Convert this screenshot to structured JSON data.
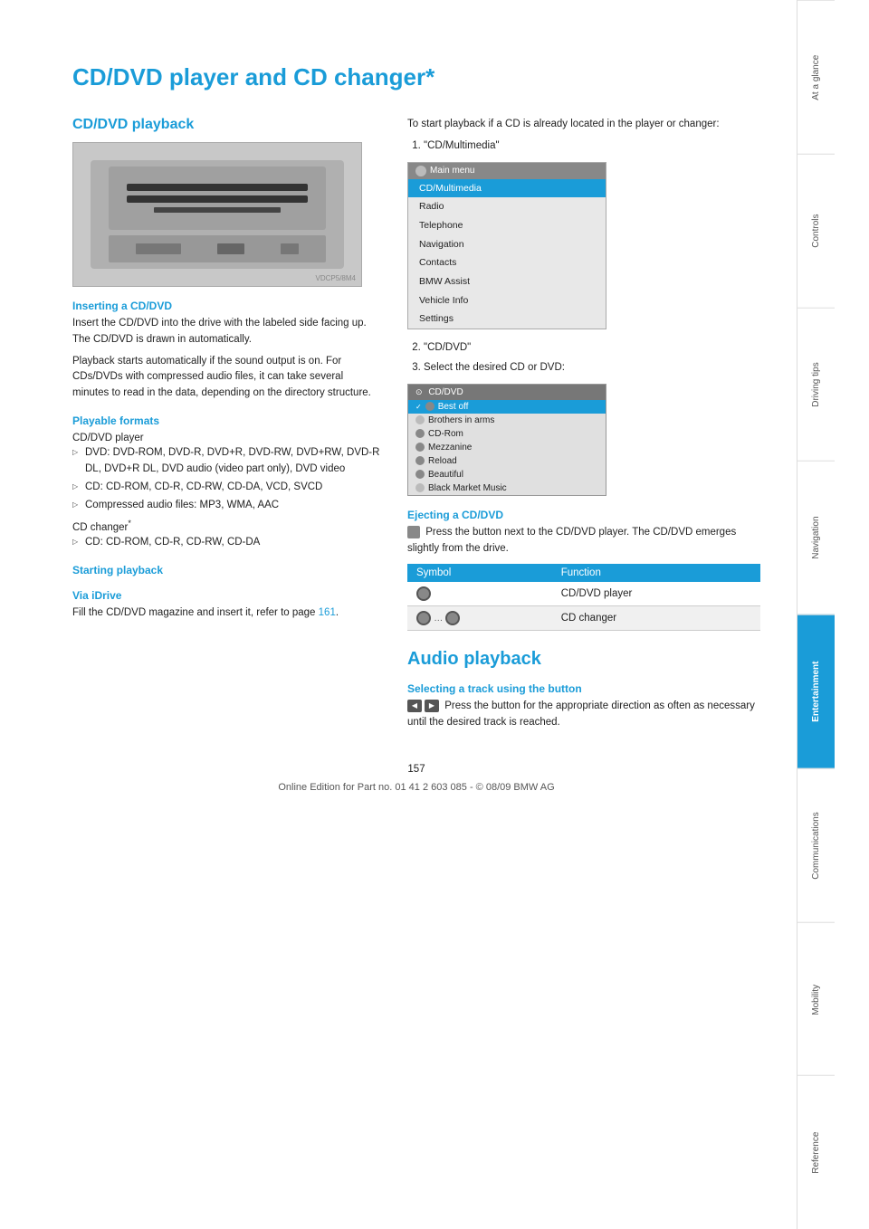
{
  "page": {
    "title": "CD/DVD player and CD changer*",
    "number": "157",
    "footer": "Online Edition for Part no. 01 41 2 603 085 - © 08/09 BMW AG"
  },
  "sidebar": {
    "tabs": [
      {
        "label": "At a glance",
        "active": false
      },
      {
        "label": "Controls",
        "active": false
      },
      {
        "label": "Driving tips",
        "active": false
      },
      {
        "label": "Navigation",
        "active": false
      },
      {
        "label": "Entertainment",
        "active": true
      },
      {
        "label": "Communications",
        "active": false
      },
      {
        "label": "Mobility",
        "active": false
      },
      {
        "label": "Reference",
        "active": false
      }
    ]
  },
  "left_column": {
    "cd_dvd_playback": {
      "heading": "CD/DVD playback",
      "inserting_heading": "Inserting a CD/DVD",
      "inserting_text1": "Insert the CD/DVD into the drive with the labeled side facing up. The CD/DVD is drawn in automatically.",
      "inserting_text2": "Playback starts automatically if the sound output is on. For CDs/DVDs with compressed audio files, it can take several minutes to read in the data, depending on the directory structure.",
      "playable_heading": "Playable formats",
      "cd_dvd_player_label": "CD/DVD player",
      "dvd_formats": "DVD: DVD-ROM, DVD-R, DVD+R, DVD-RW, DVD+RW, DVD-R DL, DVD+R DL, DVD audio (video part only), DVD video",
      "cd_formats": "CD: CD-ROM, CD-R, CD-RW, CD-DA, VCD, SVCD",
      "compressed_formats": "Compressed audio files: MP3, WMA, AAC",
      "cd_changer_label": "CD changer*",
      "cd_changer_formats": "CD: CD-ROM, CD-R, CD-RW, CD-DA"
    },
    "starting_playback": {
      "heading": "Starting playback",
      "via_idrive_heading": "Via iDrive",
      "via_idrive_text": "Fill the CD/DVD magazine and insert it, refer to page",
      "via_idrive_page": "161",
      "via_idrive_period": "."
    }
  },
  "right_column": {
    "intro_text": "To start playback if a CD is already located in the player or changer:",
    "steps": [
      {
        "number": "1.",
        "text": "\"CD/Multimedia\""
      },
      {
        "number": "2.",
        "text": "\"CD/DVD\""
      },
      {
        "number": "3.",
        "text": "Select the desired CD or DVD:"
      }
    ],
    "main_menu": {
      "header": "Main menu",
      "items": [
        {
          "label": "CD/Multimedia",
          "highlighted": true
        },
        {
          "label": "Radio",
          "highlighted": false
        },
        {
          "label": "Telephone",
          "highlighted": false
        },
        {
          "label": "Navigation",
          "highlighted": false
        },
        {
          "label": "Contacts",
          "highlighted": false
        },
        {
          "label": "BMW Assist",
          "highlighted": false
        },
        {
          "label": "Vehicle Info",
          "highlighted": false
        },
        {
          "label": "Settings",
          "highlighted": false
        }
      ]
    },
    "cd_menu": {
      "header": "CD/DVD",
      "items": [
        {
          "label": "Best off",
          "highlighted": true
        },
        {
          "label": "Brothers in arms",
          "highlighted": false
        },
        {
          "label": "CD-Rom",
          "highlighted": false
        },
        {
          "label": "Mezzanine",
          "highlighted": false
        },
        {
          "label": "Reload",
          "highlighted": false
        },
        {
          "label": "Beautiful",
          "highlighted": false
        },
        {
          "label": "Black Market Music",
          "highlighted": false
        }
      ]
    },
    "ejecting": {
      "heading": "Ejecting a CD/DVD",
      "text": "Press the button next to the CD/DVD player. The CD/DVD emerges slightly from the drive."
    },
    "symbol_table": {
      "columns": [
        "Symbol",
        "Function"
      ],
      "rows": [
        {
          "symbol": "disc",
          "function": "CD/DVD player"
        },
        {
          "symbol": "disc-range",
          "function": "CD changer"
        }
      ]
    }
  },
  "audio_section": {
    "heading": "Audio playback",
    "selecting_heading": "Selecting a track using the button",
    "selecting_text": "Press the button for the appropriate direction as often as necessary until the desired track is reached."
  }
}
